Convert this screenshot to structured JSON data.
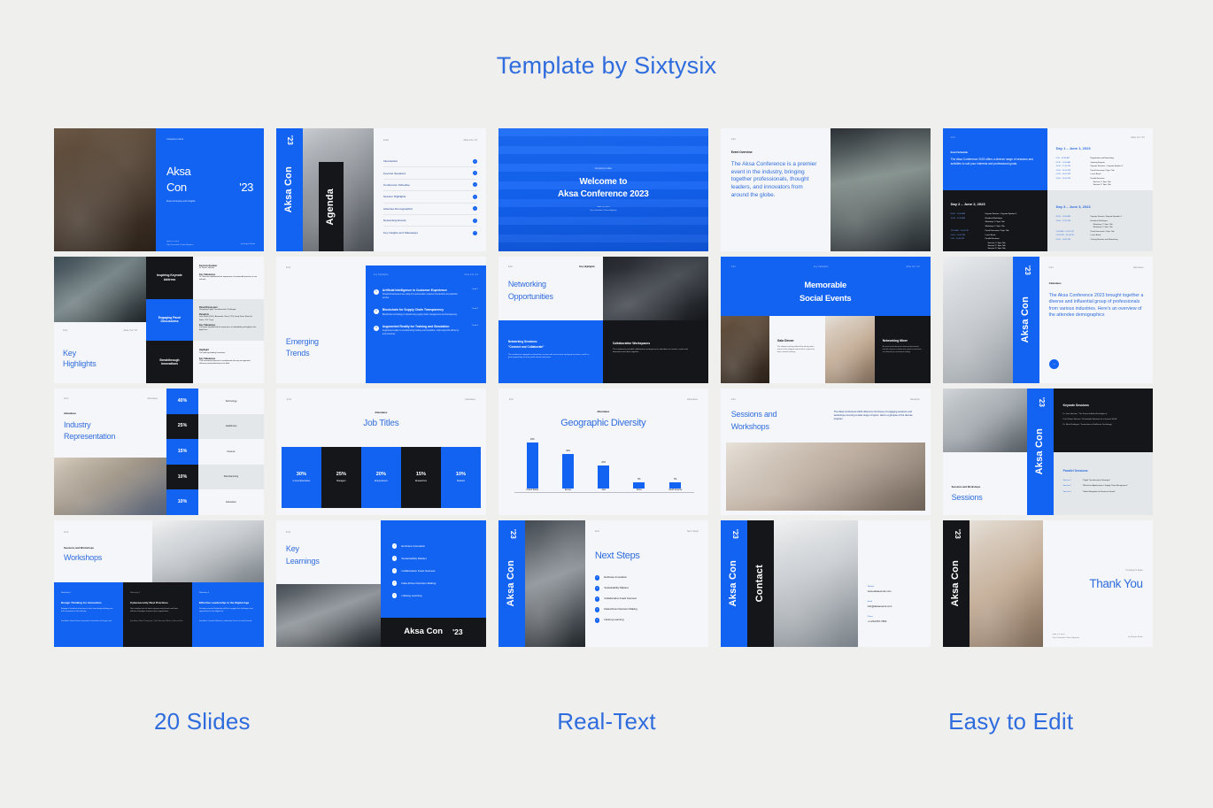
{
  "header": {
    "title": "Template by Sixtysix",
    "accent": "#2f6cdd"
  },
  "theme": {
    "blue": "#1363f3",
    "dark": "#151619",
    "light": "#f4f6f9",
    "page_bg": "#efefee",
    "title_blue": "#2f6cdd"
  },
  "footer": {
    "items": [
      "20 Slides",
      "Real-Text",
      "Easy to Edit"
    ]
  },
  "brand": {
    "name": "Aksa Con",
    "year": "'23",
    "company": "Company's Aksa"
  },
  "slides": [
    {
      "id": "cover",
      "eyebrow": "Company's Aksa",
      "title_line1": "Aksa",
      "title_line2": "Con",
      "year": "'23",
      "subtitle": "Event summary and insights",
      "date": "June 1-3, 2023",
      "venue": "City Convention Center, Anytown",
      "credit": "by Sixtysix Studio"
    },
    {
      "id": "agenda",
      "side_brand": "Aksa Con",
      "side_year": "'23",
      "side_title": "Agenda",
      "header_left": "Index",
      "header_right": "Aksa Con '23",
      "items": [
        "Introduction",
        "Keynote Speakers",
        "Conference Schedule",
        "Session Highlights",
        "Attendee Demographics",
        "Networking Events",
        "Key Insights and Takeaways"
      ]
    },
    {
      "id": "welcome",
      "eyebrow": "Company's Aksa",
      "title_line1": "Welcome to",
      "title_line2": "Aksa Conference 2023",
      "date": "June 1-3, 2023",
      "venue": "City Convention Center, Anytown"
    },
    {
      "id": "event-overview",
      "eyebrow": "Intro",
      "kicker": "Event Overview",
      "body": "The Aksa Conference is a premier event in the industry, bringing together professionals, thought leaders, and innovators from around the globe."
    },
    {
      "id": "schedule",
      "eyebrow": "Intro",
      "header_right": "Aksa Con '23",
      "intro_kicker": "Event Schedule",
      "intro_body": "The Aksa Conference 2023 offers a diverse range of sessions and activities to suit your interests and professional goals.",
      "days": [
        {
          "title": "Day 1 – June 1, 2023",
          "rows": [
            {
              "time": "9:00 – 09:30 AM",
              "text": "Registration and Networking"
            },
            {
              "time": "09:30 – 10:30 AM",
              "text": "Opening Keynote"
            },
            {
              "time": "10:30 – 12:00 PM",
              "text": "Keynote Sessions – Keynote Speaker 1"
            },
            {
              "time": "12:00 – 01:00 PM",
              "text": "Panel Discussion / Topic Title"
            },
            {
              "time": "01:00 – 02:00 PM",
              "text": "Lunch Break"
            },
            {
              "time": "02:00 – 05:00 PM",
              "text": "Parallel Sessions"
            }
          ],
          "sub": [
            "Session 1 / Topic Title",
            "Session 2 / Topic Title"
          ]
        },
        {
          "title": "Day 2 – June 2, 2023",
          "rows": [
            {
              "time": "09:00 – 10:30 AM",
              "text": "Keynote Session – Keynote Speaker 2"
            },
            {
              "time": "10:30 – 12:00 AM",
              "text": "Breakout Workshops"
            },
            {
              "time": "12:00 AM – 01:00 PM",
              "text": "Panel Discussion / Topic Title"
            },
            {
              "time": "01:00 – 02:00 PM",
              "text": "Lunch Break"
            },
            {
              "time": "2:00 – 05:00 PM",
              "text": "Parallel Sessions"
            }
          ],
          "sub": [
            "Workshop 1 / Topic Title",
            "Workshop 2 / Topic Title",
            "Session 1 / Topic Title",
            "Session 2 / Topic Title",
            "Session 3 / Topic Title"
          ]
        },
        {
          "title": "Day 3 – June 3, 2023",
          "rows": [
            {
              "time": "09:00 – 10:30 AM",
              "text": "Keynote Session / Keynote Speaker 3"
            },
            {
              "time": "10:30 – 12:00 PM",
              "text": "Breakout Workshops"
            },
            {
              "time": "12:00 AM – 01:00 PM",
              "text": "Panel Discussion / Topic Title"
            },
            {
              "time": "01:00 PM – 02:00 PM",
              "text": "Lunch Break"
            },
            {
              "time": "02:00 – 04:00 PM",
              "text": "Closing Remarks and Networking"
            }
          ],
          "sub": [
            "Workshop 1 / Topic Title",
            "Workshop 2 / Topic Title"
          ]
        }
      ]
    },
    {
      "id": "key-highlights",
      "eyebrow": "Intro",
      "header_right": "Aksa Con '23",
      "title_line1": "Key",
      "title_line2": "Highlights",
      "tiles": [
        {
          "label": "Inspiring Keynote Address",
          "bg": "dark"
        },
        {
          "label": "Engaging Panel Discussions",
          "bg": "blue"
        },
        {
          "label": "Breakthrough Innovations",
          "bg": "dark"
        }
      ],
      "notes": [
        {
          "kicker": "Keynote Speaker",
          "sub": "Dr. Sarah Johnson",
          "kicker2": "Key Takeaways",
          "body": "Dr. Johnson emphasized the importance of sustainable practices in our industry."
        },
        {
          "kicker": "Panel Discussion",
          "sub": "Navigating Digital Transformation Challenges",
          "kicker2": "Panelists",
          "sub2": "John Smith (CEO), Alexander Chen (CTO), Emily Davis (Head of Sales, XYZ Corp)",
          "kicker3": "Key Takeaways",
          "body": "The panel emphasized the importance of adaptability and agility in the digital era."
        },
        {
          "kicker": "Highlight",
          "sub": "The Industry-leading Innovation",
          "kicker2": "Key Takeaways",
          "body": "This innovation promises to revolutionize the way we approach efficiency and productivity in the field."
        }
      ]
    },
    {
      "id": "emerging-trends",
      "eyebrow": "Intro",
      "title_line1": "Emerging",
      "title_line2": "Trends",
      "panel_header_left": "Key Highlights",
      "panel_header_right": "Aksa Con '23",
      "items": [
        {
          "n": "1",
          "title": "Artificial Intelligence in Customer Experience",
          "body": "Powerful businesses are using AI to personalize customer interactions and optimize service.",
          "tag": "Trend 1"
        },
        {
          "n": "2",
          "title": "Blockchain for Supply Chain Transparency",
          "body": "Blockchain technology is transforming supply chain management and transparency.",
          "tag": "Trend 2"
        },
        {
          "n": "3",
          "title": "Augmented Reality for Training and Simulation",
          "body": "Augmented reality is revolutionizing training and simulation, improving both efficiency and outcomes.",
          "tag": "Trend 3"
        }
      ]
    },
    {
      "id": "networking-opportunities",
      "eyebrow": "Intro",
      "header_right": "Key Highlights",
      "title_line1": "Networking",
      "title_line2": "Opportunities",
      "blue_kicker": "Networking Sessions:",
      "blue_quote": "\"Connect and Collaborate\"",
      "blue_body": "The conference engaged an interactive session with one-on-one and group sessions, and it's a great opportunity to meet professionals and peers.",
      "dark_kicker": "Collaborative Workspaces",
      "dark_body": "The conference provided collaborative workspaces for attendees to connect, create and brainstorm new ideas together."
    },
    {
      "id": "social-events",
      "eyebrow": "Intro",
      "header_center": "Key Highlights",
      "header_right": "Aksa Con '23",
      "title_line1": "Memorable",
      "title_line2": "Social Events",
      "cards": [
        {
          "kicker": "Gala Dinner",
          "body": "The elegant evening offered fine dining and a chance to be elegant and social in a space far from a formal meeting."
        },
        {
          "kicker": "Networking Mixer",
          "body": "A casual and interactive where professionals met the chance to make new contacts and have an informal yet convenient setting."
        }
      ]
    },
    {
      "id": "attendees-intro",
      "side_brand": "Aksa Con",
      "side_year": "'23",
      "eyebrow": "Intro",
      "header_right": "Attendees",
      "kicker": "Attendees",
      "body": "The Aksa Conference 2023 brought together a diverse and influential group of professionals from various industries. Here's an overview of the attendee demographics",
      "arrow": "arrow-right-icon"
    },
    {
      "id": "industry-representation",
      "eyebrow": "Intro",
      "header_right": "Attendees",
      "kicker": "Attendees",
      "title_line1": "Industry",
      "title_line2": "Representation",
      "chart_type": "stat-bars"
    },
    {
      "id": "job-titles",
      "eyebrow": "Intro",
      "header_right": "Attendees",
      "kicker": "Attendees",
      "title": "Job Titles"
    },
    {
      "id": "geographic-diversity",
      "eyebrow": "Intro",
      "header_right": "Attendees",
      "kicker": "Attendees",
      "title": "Geographic Diversity"
    },
    {
      "id": "sessions-and-workshops",
      "eyebrow": "Intro",
      "header_right": "Sessions",
      "title_line1": "Sessions and",
      "title_line2": "Workshops",
      "body": "The Aksa Conference 2023 offered a rich lineup of engaging sessions and workshops covering a wide range of topics. Here's a glimpse of the diverse program."
    },
    {
      "id": "sessions",
      "side_brand": "Aksa Con",
      "side_year": "'23",
      "kicker": "Sessions and Workshops",
      "title": "Sessions",
      "dark_kicker": "Keynote Sessions",
      "keynotes": [
        "Dr. Jane Harrison: \"The Future of Artificial Intelligence\"",
        "Prof. Robert Johnson: \"Sustainable Solutions for a Greener World\"",
        "Dr. Maria Rodriguez: \"Innovations in Healthcare Technology\""
      ],
      "parallel_kicker": "Parallel Sessions",
      "parallel": [
        {
          "tag": "Session 1",
          "text": "\"Digital Transformation Strategies\""
        },
        {
          "tag": "Session 2",
          "text": "\"Blockchain Applications in Supply Chain Management\""
        },
        {
          "tag": "Session 3",
          "text": "\"Global Navigation for Business Growth\""
        }
      ]
    },
    {
      "id": "workshops",
      "eyebrow": "Intro",
      "kicker": "Sessions and Workshops",
      "title": "Workshops",
      "cards": [
        {
          "tag": "Workshop 1",
          "title": "Design Thinking for Innovation",
          "body": "Engage in hands-on exercises to learn how design thinking can drive innovation in the industry.",
          "footer": "Facilitator: Sarah Davis, Innovation Consultant at Design Labs",
          "bg": "blue"
        },
        {
          "tag": "Workshop 2",
          "title": "Cybersecurity Best Practices",
          "body": "Gain insights into the latest cybersecurity threats and learn effective strategies to protect your organization.",
          "footer": "Facilitator: Mark Thompson, Chief Security Officer at SecureTech",
          "bg": "dark"
        },
        {
          "tag": "Workshop 3",
          "title": "Effective Leadership in the Digital Age",
          "body": "Develop essential leadership skills to navigate the challenges and opportunities in the digital era.",
          "footer": "Facilitator: Jennifer Roberts, Leadership Coach at Lead Forward",
          "bg": "blue"
        }
      ]
    },
    {
      "id": "key-learnings",
      "eyebrow": "Intro",
      "title_line1": "Key",
      "title_line2": "Learnings",
      "items": [
        "Embrace Innovation",
        "Sustainability Matters",
        "Collaboration Fuels Success",
        "Data-Driven Decision Making",
        "Lifelong Learning"
      ],
      "badge_brand": "Aksa Con",
      "badge_year": "'23"
    },
    {
      "id": "next-steps",
      "side_brand": "Aksa Con",
      "side_year": "'23",
      "eyebrow": "Intro",
      "header_right": "Next Steps",
      "title": "Next Steps",
      "items": [
        "Embrace Innovation",
        "Sustainability Matters",
        "Collaboration Fuels Success",
        "Data-Driven Decision Making",
        "Lifelong Learning"
      ]
    },
    {
      "id": "contact",
      "side_brand": "Aksa Con",
      "side_year": "'23",
      "side_title": "Contact",
      "fields": [
        {
          "label": "Website",
          "value": "www.aksaevents.com"
        },
        {
          "label": "Email",
          "value": "info@aksaevents.com"
        },
        {
          "label": "Phone",
          "value": "+1-234-567-7890"
        }
      ]
    },
    {
      "id": "thank-you",
      "side_brand": "Aksa Con",
      "side_year": "'23",
      "eyebrow": "Company's Aksa",
      "title": "Thank You",
      "date": "June 1-3, 2023",
      "venue": "City Convention Center, Anytown",
      "credit": "by Sixtysix Studio"
    }
  ],
  "chart_data": [
    {
      "type": "bar",
      "orientation": "horizontal-stat",
      "title": "Industry Representation",
      "subtitle": "Attendees",
      "categories": [
        "Technology",
        "Healthcare",
        "Finance",
        "Manufacturing",
        "Education"
      ],
      "values": [
        40,
        25,
        15,
        10,
        10
      ],
      "value_labels": [
        "40%",
        "25%",
        "15%",
        "10%",
        "10%"
      ],
      "row_colors": [
        "#1363f3",
        "#151619",
        "#1363f3",
        "#151619",
        "#1363f3"
      ],
      "name_colors": [
        "#f4f6f9",
        "#dcdfe2",
        "#f4f6f9",
        "#dcdfe2",
        "#f4f6f9"
      ],
      "xlabel": "",
      "ylabel": "",
      "grid": false,
      "legend": "none"
    },
    {
      "type": "bar",
      "orientation": "columns-stat",
      "title": "Job Titles",
      "subtitle": "Attendees",
      "categories": [
        "C-Level Executives",
        "Managers",
        "Entrepreneurs",
        "Researchers",
        "Students"
      ],
      "values": [
        30,
        25,
        20,
        15,
        10
      ],
      "value_labels": [
        "30%",
        "25%",
        "20%",
        "15%",
        "10%"
      ],
      "col_colors": [
        "#1363f3",
        "#151619",
        "#1363f3",
        "#151619",
        "#1363f3"
      ],
      "xlabel": "",
      "ylabel": "",
      "grid": false,
      "legend": "none"
    },
    {
      "type": "bar",
      "orientation": "vertical",
      "title": "Geographic Diversity",
      "subtitle": "Attendees",
      "categories": [
        "United States",
        "Europe",
        "Asia",
        "Africa",
        "South America"
      ],
      "values": [
        40,
        30,
        20,
        5,
        5
      ],
      "value_labels": [
        "40%",
        "30%",
        "20%",
        "5%",
        "5%"
      ],
      "bar_color": "#1363f3",
      "ylim": [
        0,
        45
      ],
      "xlabel": "",
      "ylabel": "",
      "grid": false,
      "legend": "none"
    }
  ]
}
